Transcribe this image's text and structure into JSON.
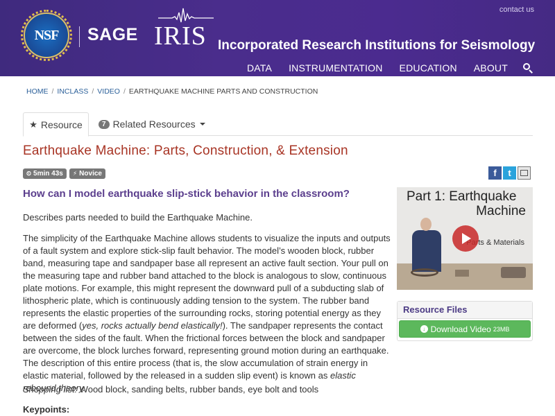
{
  "header": {
    "contact": "contact us",
    "nsf": "NSF",
    "sage": "SAGE",
    "iris": "IRIS",
    "org_name": "Incorporated Research Institutions for Seismology",
    "nav": [
      "DATA",
      "INSTRUMENTATION",
      "EDUCATION",
      "ABOUT"
    ],
    "colors": {
      "brand_purple": "#4a2d8c"
    }
  },
  "breadcrumb": [
    "HOME",
    "INCLASS",
    "VIDEO",
    "EARTHQUAKE MACHINE PARTS AND CONSTRUCTION"
  ],
  "tabs": {
    "resource": "Resource",
    "related_count": "7",
    "related": "Related Resources"
  },
  "title": "Earthquake Machine: Parts, Construction, & Extension",
  "labels": {
    "duration": "5min 43s",
    "level": "Novice"
  },
  "share": {
    "facebook": "f",
    "twitter": "t"
  },
  "question": "How can I model earthquake slip-stick behavior in the classroom?",
  "intro": "Describes parts needed to build the Earthquake Machine.",
  "body": {
    "part1": "The simplicity of the Earthquake Machine allows students to visualize the inputs and outputs of a fault system and explore stick-slip fault behavior. The model’s wooden block, rubber band, measuring tape and sandpaper base all represent an active fault section. Your pull on the measuring tape and rubber band attached to the block is analogous to slow, continuous plate motions. For example, this might represent the downward pull of a subducting slab of lithospheric plate, which is continuously adding tension to the system. The rubber band represents the elastic properties of the surrounding rocks, storing potential energy as they are deformed (",
    "italic1": "yes, rocks actually bend elastically!",
    "part2": "). The sandpaper represents the contact between the sides of the fault. When the frictional forces between the block and sandpaper are overcome, the block lurches forward, representing ground motion during an earthquake. The description of this entire process (that is, the slow accumulation of strain energy in elastic material, followed by the released in a sudden slip event) is known as ",
    "italic2": "elastic rebound theory."
  },
  "shopping": {
    "label": "Shopping list:",
    "text": " Wood block, sanding belts, rubber bands, eye bolt and tools"
  },
  "keypoints": "Keypoints:",
  "video": {
    "line1": "Part 1:  Earthquake",
    "line2": "Machine",
    "line3": "Parts & Materials"
  },
  "resource_files": {
    "heading": "Resource Files",
    "button": "Download Video",
    "size": "23MB"
  }
}
